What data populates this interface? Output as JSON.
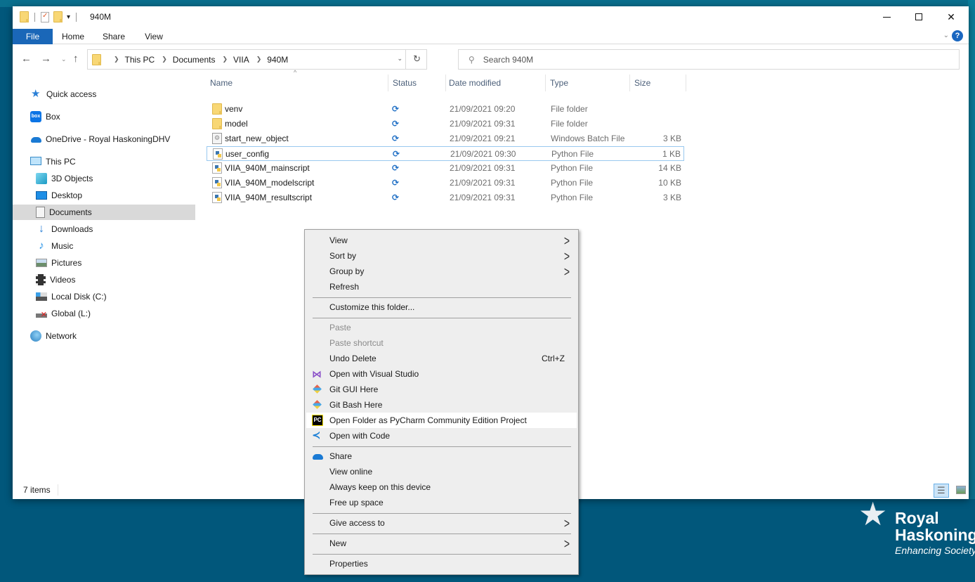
{
  "window": {
    "title": "940M",
    "controls": {
      "minimize": "—",
      "maximize": "☐",
      "close": "✕"
    }
  },
  "ribbon": {
    "tabs": [
      {
        "label": "File",
        "active": true
      },
      {
        "label": "Home"
      },
      {
        "label": "Share"
      },
      {
        "label": "View"
      }
    ],
    "help": "?",
    "expand_icon": "⌄"
  },
  "navigation": {
    "back": "←",
    "forward": "→",
    "recent": "⌄",
    "up": "↑",
    "breadcrumb": [
      "This PC",
      "Documents",
      "VIIA",
      "940M"
    ],
    "dropdown": "⌄",
    "refresh": "↻",
    "search_placeholder": "Search 940M",
    "search_value": ""
  },
  "sidebar": {
    "items": [
      {
        "label": "Quick access",
        "icon": "star-icon"
      },
      {
        "label": "Box",
        "icon": "box-icon"
      },
      {
        "label": "OneDrive - Royal HaskoningDHV",
        "icon": "onedrive-icon"
      },
      {
        "label": "This PC",
        "icon": "computer-icon"
      },
      {
        "label": "3D Objects",
        "icon": "cube-icon"
      },
      {
        "label": "Desktop",
        "icon": "desktop-icon"
      },
      {
        "label": "Documents",
        "icon": "documents-icon",
        "selected": true
      },
      {
        "label": "Downloads",
        "icon": "download-icon"
      },
      {
        "label": "Music",
        "icon": "music-icon"
      },
      {
        "label": "Pictures",
        "icon": "pictures-icon"
      },
      {
        "label": "Videos",
        "icon": "videos-icon"
      },
      {
        "label": "Local Disk (C:)",
        "icon": "disk-icon"
      },
      {
        "label": "Global (L:)",
        "icon": "network-drive-disconnected-icon"
      },
      {
        "label": "Network",
        "icon": "network-icon"
      }
    ]
  },
  "filelist": {
    "columns": [
      "Name",
      "Status",
      "Date modified",
      "Type",
      "Size"
    ],
    "sort_indicator": "^",
    "status_glyph": "⟳",
    "rows": [
      {
        "name": "venv",
        "date": "21/09/2021 09:20",
        "type": "File folder",
        "size": "",
        "icon": "folder-icon"
      },
      {
        "name": "model",
        "date": "21/09/2021 09:31",
        "type": "File folder",
        "size": "",
        "icon": "folder-icon"
      },
      {
        "name": "start_new_object",
        "date": "21/09/2021 09:21",
        "type": "Windows Batch File",
        "size": "3 KB",
        "icon": "batch-file-icon"
      },
      {
        "name": "user_config",
        "date": "21/09/2021 09:30",
        "type": "Python File",
        "size": "1 KB",
        "icon": "python-file-icon",
        "focused": true
      },
      {
        "name": "VIIA_940M_mainscript",
        "date": "21/09/2021 09:31",
        "type": "Python File",
        "size": "14 KB",
        "icon": "python-file-icon"
      },
      {
        "name": "VIIA_940M_modelscript",
        "date": "21/09/2021 09:31",
        "type": "Python File",
        "size": "10 KB",
        "icon": "python-file-icon"
      },
      {
        "name": "VIIA_940M_resultscript",
        "date": "21/09/2021 09:31",
        "type": "Python File",
        "size": "3 KB",
        "icon": "python-file-icon"
      }
    ]
  },
  "statusbar": {
    "count": "7 items"
  },
  "context_menu": {
    "items": [
      {
        "label": "View",
        "submenu": true
      },
      {
        "label": "Sort by",
        "submenu": true
      },
      {
        "label": "Group by",
        "submenu": true
      },
      {
        "label": "Refresh"
      },
      {
        "label": "Customize this folder..."
      },
      {
        "label": "Paste",
        "disabled": true
      },
      {
        "label": "Paste shortcut",
        "disabled": true
      },
      {
        "label": "Undo Delete",
        "shortcut": "Ctrl+Z"
      },
      {
        "label": "Open with Visual Studio",
        "icon": "visual-studio-icon"
      },
      {
        "label": "Git GUI Here",
        "icon": "git-icon"
      },
      {
        "label": "Git Bash Here",
        "icon": "git-icon"
      },
      {
        "label": "Open Folder as PyCharm Community Edition Project",
        "icon": "pycharm-icon",
        "hover": true
      },
      {
        "label": "Open with Code",
        "icon": "vscode-icon"
      },
      {
        "label": "Share",
        "icon": "onedrive-icon"
      },
      {
        "label": "View online"
      },
      {
        "label": "Always keep on this device"
      },
      {
        "label": "Free up space"
      },
      {
        "label": "Give access to",
        "submenu": true
      },
      {
        "label": "New",
        "submenu": true
      },
      {
        "label": "Properties"
      }
    ],
    "arrow_glyph": ">",
    "pycharm_badge": "PC"
  },
  "wallpaper": {
    "logo_line1": "Royal",
    "logo_line2": "Haskoning",
    "tagline": "Enhancing Society"
  },
  "colors": {
    "desktop": "#01577b",
    "file_tab": "#1a67b8",
    "selection": "#d9d9d9",
    "menu_bg": "#eeeeee",
    "sync_blue": "#1f6fc5"
  }
}
